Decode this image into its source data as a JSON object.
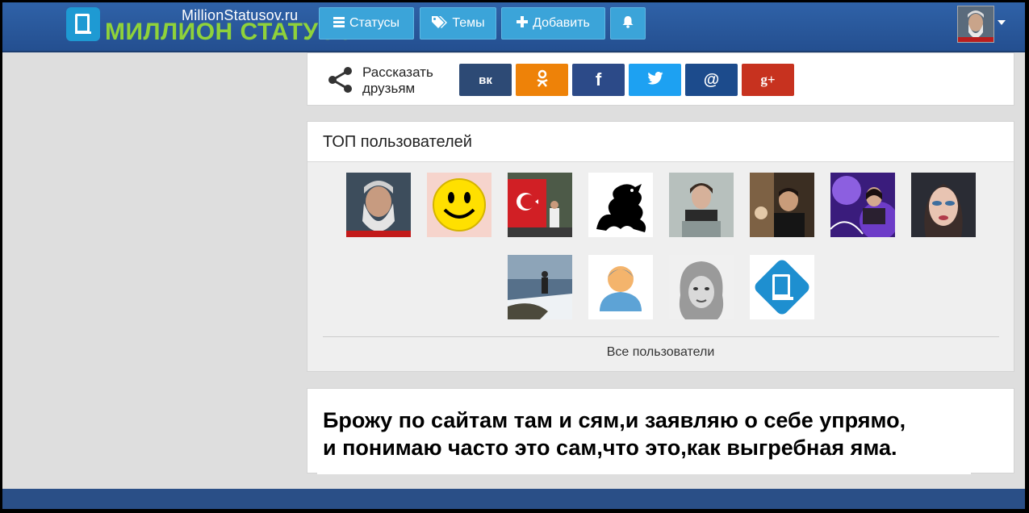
{
  "header": {
    "logo_domain": "MillionStatusov.ru",
    "logo_name": "МИЛЛИОН СТАТУСОВ",
    "nav": [
      {
        "label": "Статусы",
        "icon": "menu-icon"
      },
      {
        "label": "Темы",
        "icon": "tags-icon"
      },
      {
        "label": "Добавить",
        "icon": "plus-icon"
      }
    ],
    "bell_icon": "bell-icon"
  },
  "share": {
    "label": "Рассказать друзьям",
    "buttons": [
      {
        "label": "вк",
        "network": "vkontakte",
        "color": "#2d4a75"
      },
      {
        "label": "ok",
        "network": "odnoklassniki",
        "color": "#ee8208"
      },
      {
        "label": "f",
        "network": "facebook",
        "color": "#2c4a88"
      },
      {
        "label": "t",
        "network": "twitter",
        "color": "#1da1f2"
      },
      {
        "label": "@",
        "network": "mail",
        "color": "#1c4b8c"
      },
      {
        "label": "g+",
        "network": "google-plus",
        "color": "#c7321f"
      }
    ]
  },
  "top_users": {
    "title": "ТОП пользователей",
    "users": [
      "bearded-man-avatar",
      "smiley-avatar",
      "turkey-flag-avatar",
      "dragon-avatar",
      "woman-photo-avatar",
      "man-photo-avatar",
      "purple-avatar",
      "makeup-avatar",
      "landscape-avatar",
      "default-user-avatar",
      "fur-hat-avatar",
      "site-logo-avatar"
    ],
    "all_link": "Все пользователи"
  },
  "quote": {
    "line1": "Брожу по сайтам там и сям,и заявляю о себе упрямо,",
    "line2": "и понимаю часто это сам,что это,как выгребная яма."
  }
}
